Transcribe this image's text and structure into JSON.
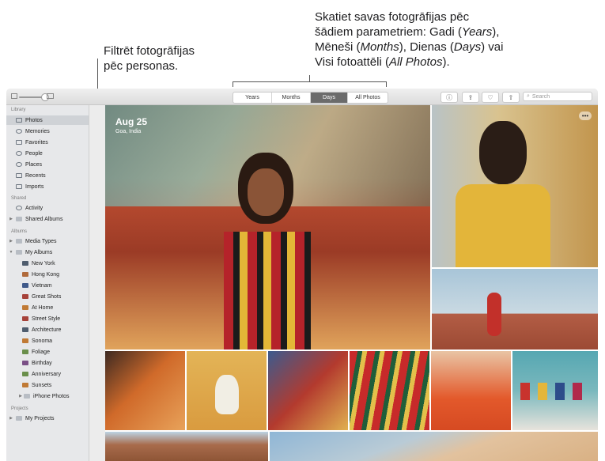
{
  "callouts": {
    "people_l1": "Filtrēt fotogrāfijas",
    "people_l2": "pēc personas.",
    "view_l1": "Skatiet savas fotogrāfijas pēc",
    "view_l2": "šādiem parametriem: Gadi (",
    "view_years": "Years",
    "view_l2_end": "),",
    "view_l3a": "Mēneši (",
    "view_months": "Months",
    "view_l3b": "), Dienas (",
    "view_days": "Days",
    "view_l3c": ") vai",
    "view_l4a": "Visi fotoattēli (",
    "view_allphotos": "All Photos",
    "view_l4b": ")."
  },
  "toolbar": {
    "tabs": [
      {
        "label": "Years",
        "active": false
      },
      {
        "label": "Months",
        "active": false
      },
      {
        "label": "Days",
        "active": true
      },
      {
        "label": "All Photos",
        "active": false
      }
    ],
    "info_icon": "ⓘ",
    "share_icon": "⇪",
    "heart_icon": "♡",
    "rotate_icon": "⇧",
    "search_placeholder": "Search"
  },
  "sidebar": {
    "library_heading": "Library",
    "library": [
      {
        "label": "Photos",
        "icon": "photos-icon",
        "selected": true
      },
      {
        "label": "Memories",
        "icon": "memories-icon"
      },
      {
        "label": "Favorites",
        "icon": "heart-icon"
      },
      {
        "label": "People",
        "icon": "person-icon"
      },
      {
        "label": "Places",
        "icon": "pin-icon"
      },
      {
        "label": "Recents",
        "icon": "clock-icon"
      },
      {
        "label": "Imports",
        "icon": "import-icon"
      }
    ],
    "shared_heading": "Shared",
    "shared": [
      {
        "label": "Activity",
        "icon": "cloud-icon"
      },
      {
        "label": "Shared Albums",
        "icon": "folder-icon"
      }
    ],
    "albums_heading": "Albums",
    "albums": [
      {
        "label": "Media Types"
      },
      {
        "label": "My Albums"
      },
      {
        "label": "New York"
      },
      {
        "label": "Hong Kong"
      },
      {
        "label": "Vietnam"
      },
      {
        "label": "Great Shots"
      },
      {
        "label": "At Home"
      },
      {
        "label": "Street Style"
      },
      {
        "label": "Architecture"
      },
      {
        "label": "Sonoma"
      },
      {
        "label": "Foliage"
      },
      {
        "label": "Birthday"
      },
      {
        "label": "Anniversary"
      },
      {
        "label": "Sunsets"
      },
      {
        "label": "iPhone Photos"
      }
    ],
    "projects_heading": "Projects",
    "projects": [
      {
        "label": "My Projects"
      }
    ]
  },
  "main": {
    "date": "Aug 25",
    "location": "Goa, India",
    "more_icon": "•••"
  }
}
